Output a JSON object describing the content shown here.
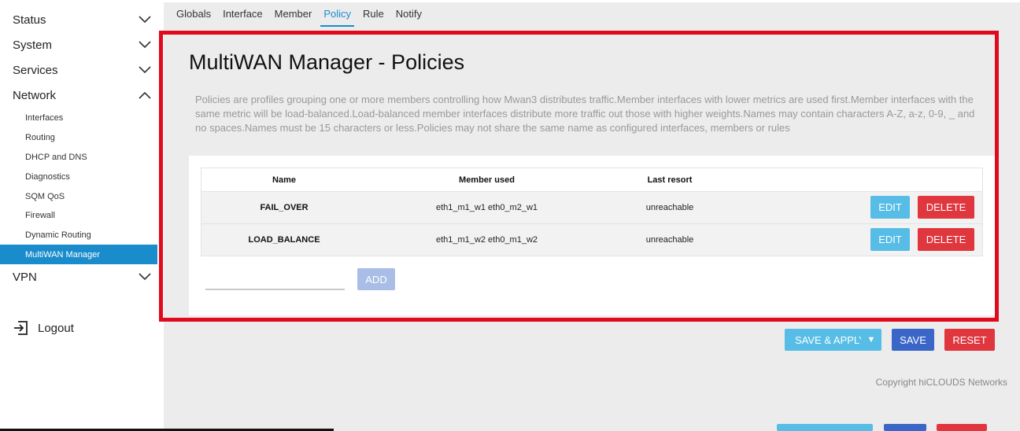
{
  "sidebar": {
    "status": "Status",
    "system": "System",
    "services": "Services",
    "network": "Network",
    "network_items": [
      "Interfaces",
      "Routing",
      "DHCP and DNS",
      "Diagnostics",
      "SQM QoS",
      "Firewall",
      "Dynamic Routing",
      "MultiWAN Manager"
    ],
    "vpn": "VPN",
    "logout": "Logout"
  },
  "tabs": [
    "Globals",
    "Interface",
    "Member",
    "Policy",
    "Rule",
    "Notify"
  ],
  "active_tab": "Policy",
  "page": {
    "title": "MultiWAN Manager - Policies",
    "description": "Policies are profiles grouping one or more members controlling how Mwan3 distributes traffic.Member interfaces with lower metrics are used first.Member interfaces with the same metric will be load-balanced.Load-balanced member interfaces distribute more traffic out those with higher weights.Names may contain characters A-Z, a-z, 0-9, _ and no spaces.Names must be 15 characters or less.Policies may not share the same name as configured interfaces, members or rules"
  },
  "table": {
    "headers": {
      "name": "Name",
      "member": "Member used",
      "last": "Last resort"
    },
    "rows": [
      {
        "name": "FAIL_OVER",
        "member": "eth1_m1_w1 eth0_m2_w1",
        "last": "unreachable",
        "edit": "EDIT",
        "delete": "DELETE"
      },
      {
        "name": "LOAD_BALANCE",
        "member": "eth1_m1_w2 eth0_m1_w2",
        "last": "unreachable",
        "edit": "EDIT",
        "delete": "DELETE"
      }
    ]
  },
  "add": {
    "value": "",
    "button": "ADD"
  },
  "actions": {
    "save_apply": "SAVE & APPLY",
    "save": "SAVE",
    "reset": "RESET"
  },
  "copyright": "Copyright hiCLOUDS Networks",
  "colors": {
    "accent": "#1b8ccb",
    "highlight_outline": "#e10a1d",
    "edit": "#57bde6",
    "delete": "#e0373f",
    "save": "#3a66c8"
  }
}
